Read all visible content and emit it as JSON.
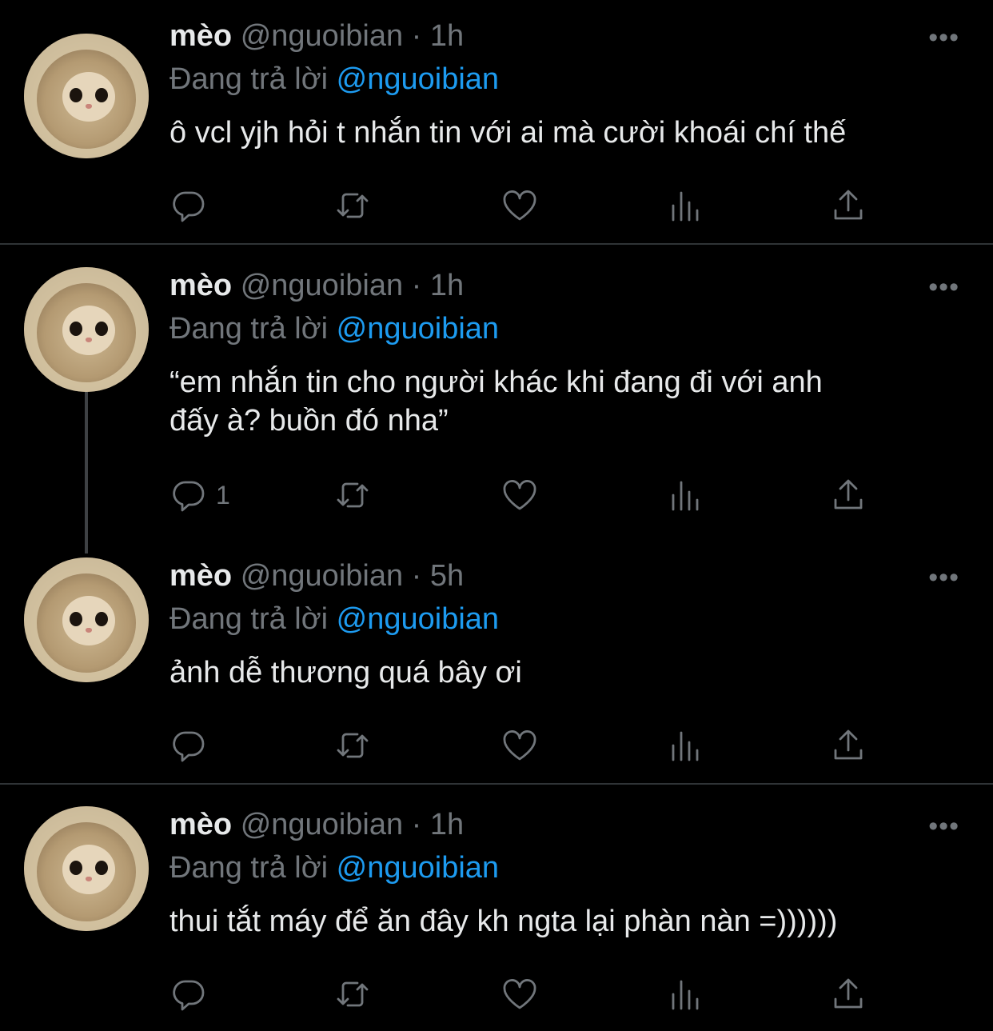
{
  "tweets": [
    {
      "name": "mèo",
      "handle": "@nguoibian",
      "sep": "·",
      "time": "1h",
      "more": "•••",
      "reply_prefix": "Đang trả lời",
      "reply_to": "@nguoibian",
      "lines": [
        "ô vcl yjh hỏi t nhắn tin với ai mà cười khoái chí thế"
      ],
      "reply_count": ""
    },
    {
      "name": "mèo",
      "handle": "@nguoibian",
      "sep": "·",
      "time": "1h",
      "more": "•••",
      "reply_prefix": "Đang trả lời",
      "reply_to": "@nguoibian",
      "lines": [
        "“em nhắn tin cho người khác khi đang đi với anh",
        "đấy à? buồn đó nha”"
      ],
      "reply_count": "1"
    },
    {
      "name": "mèo",
      "handle": "@nguoibian",
      "sep": "·",
      "time": "5h",
      "more": "•••",
      "reply_prefix": "Đang trả lời",
      "reply_to": "@nguoibian",
      "lines": [
        "ảnh dễ thương quá bây ơi"
      ],
      "reply_count": ""
    },
    {
      "name": "mèo",
      "handle": "@nguoibian",
      "sep": "·",
      "time": "1h",
      "more": "•••",
      "reply_prefix": "Đang trả lời",
      "reply_to": "@nguoibian",
      "lines": [
        "thui tắt máy để ăn đây kh ngta lại phàn nàn =))))))"
      ],
      "reply_count": ""
    }
  ],
  "icons": [
    "reply-icon",
    "retweet-icon",
    "like-icon",
    "views-icon",
    "share-icon",
    "more-icon"
  ],
  "colors": {
    "background": "#000000",
    "text": "#e7e9ea",
    "muted": "#71767b",
    "mention": "#1d9bf0",
    "divider": "#2f3336"
  }
}
